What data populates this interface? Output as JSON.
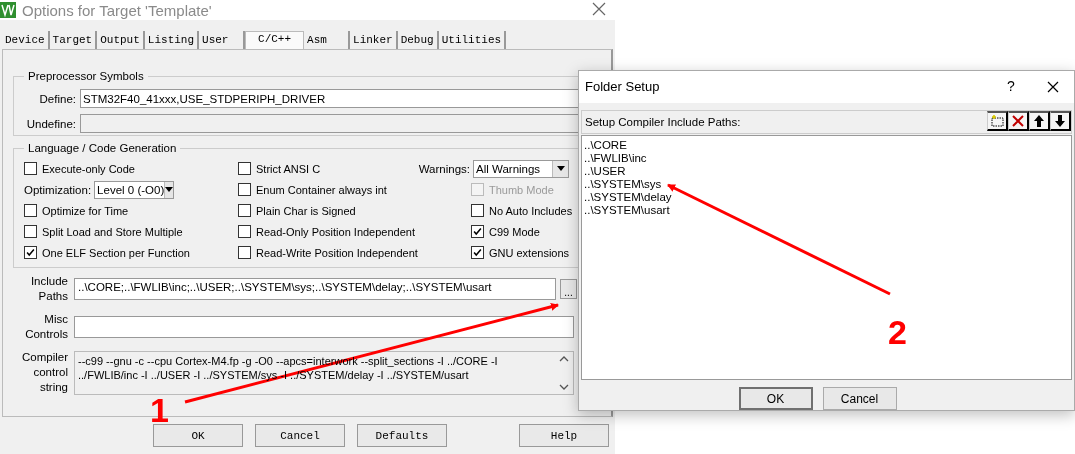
{
  "window": {
    "title": "Options for Target 'Template'"
  },
  "tabs": [
    {
      "label": "Device",
      "selected": false
    },
    {
      "label": "Target",
      "selected": false
    },
    {
      "label": "Output",
      "selected": false
    },
    {
      "label": "Listing",
      "selected": false
    },
    {
      "label": "User",
      "selected": false
    },
    {
      "label": "C/C++",
      "selected": true
    },
    {
      "label": "Asm",
      "selected": false
    },
    {
      "label": "Linker",
      "selected": false
    },
    {
      "label": "Debug",
      "selected": false
    },
    {
      "label": "Utilities",
      "selected": false
    }
  ],
  "preprocessor": {
    "title": "Preprocessor Symbols",
    "define_label": "Define:",
    "define": "STM32F40_41xxx,USE_STDPERIPH_DRIVER",
    "undefine_label": "Undefine:",
    "undefine_disabled": true
  },
  "language": {
    "title": "Language / Code Generation",
    "columns": [
      {
        "items": [
          {
            "kind": "checkbox",
            "label": "Execute-only Code",
            "checked": false,
            "disabled": false
          },
          {
            "kind": "dropdown",
            "label": "Optimization:",
            "value": "Level 0 (-O0)"
          },
          {
            "kind": "checkbox",
            "label": "Optimize for Time",
            "checked": false,
            "disabled": false
          },
          {
            "kind": "checkbox",
            "label": "Split Load and Store Multiple",
            "checked": false,
            "disabled": false
          },
          {
            "kind": "checkbox",
            "label": "One ELF Section per Function",
            "checked": true,
            "disabled": false
          }
        ]
      },
      {
        "items": [
          {
            "kind": "checkbox",
            "label": "Strict ANSI C",
            "checked": false,
            "disabled": false
          },
          {
            "kind": "checkbox",
            "label": "Enum Container always int",
            "checked": false,
            "disabled": false
          },
          {
            "kind": "checkbox",
            "label": "Plain Char is Signed",
            "checked": false,
            "disabled": false
          },
          {
            "kind": "checkbox",
            "label": "Read-Only Position Independent",
            "checked": false,
            "disabled": false
          },
          {
            "kind": "checkbox",
            "label": "Read-Write Position Independent",
            "checked": false,
            "disabled": false
          }
        ]
      },
      {
        "items": [
          {
            "kind": "dropdown",
            "label": "Warnings:",
            "value": "All Warnings"
          },
          {
            "kind": "checkbox",
            "label": "Thumb Mode",
            "checked": false,
            "disabled": true
          },
          {
            "kind": "checkbox",
            "label": "No Auto Includes",
            "checked": false,
            "disabled": false
          },
          {
            "kind": "checkbox",
            "label": "C99 Mode",
            "checked": true,
            "disabled": false
          },
          {
            "kind": "checkbox",
            "label": "GNU extensions",
            "checked": true,
            "disabled": false
          }
        ]
      }
    ]
  },
  "include_paths": {
    "label": "Include Paths",
    "value": "..\\CORE;..\\FWLIB\\inc;..\\USER;..\\SYSTEM\\sys;..\\SYSTEM\\delay;..\\SYSTEM\\usart",
    "browse": "..."
  },
  "misc_controls": {
    "label": "Misc Controls"
  },
  "compiler_string": {
    "label": "Compiler control string",
    "value": "--c99 --gnu -c --cpu Cortex-M4.fp -g -O0 --apcs=interwork --split_sections -I ../CORE -I ../FWLIB/inc -I ../USER -I ../SYSTEM/sys -I ../SYSTEM/delay -I ../SYSTEM/usart"
  },
  "buttons": [
    "OK",
    "Cancel",
    "Defaults",
    "Help"
  ],
  "folder_setup": {
    "title": "Folder Setup",
    "help": "?",
    "toolbar_label": "Setup Compiler Include Paths:",
    "paths": [
      {
        "label": "..\\CORE"
      },
      {
        "label": "..\\FWLIB\\inc"
      },
      {
        "label": "..\\USER"
      },
      {
        "label": "..\\SYSTEM\\sys"
      },
      {
        "label": "..\\SYSTEM\\delay"
      },
      {
        "label": "..\\SYSTEM\\usart"
      }
    ],
    "buttons": [
      {
        "label": "OK",
        "default": true
      },
      {
        "label": "Cancel",
        "default": false
      }
    ]
  },
  "annotations": [
    {
      "label": "1"
    },
    {
      "label": "2"
    }
  ]
}
